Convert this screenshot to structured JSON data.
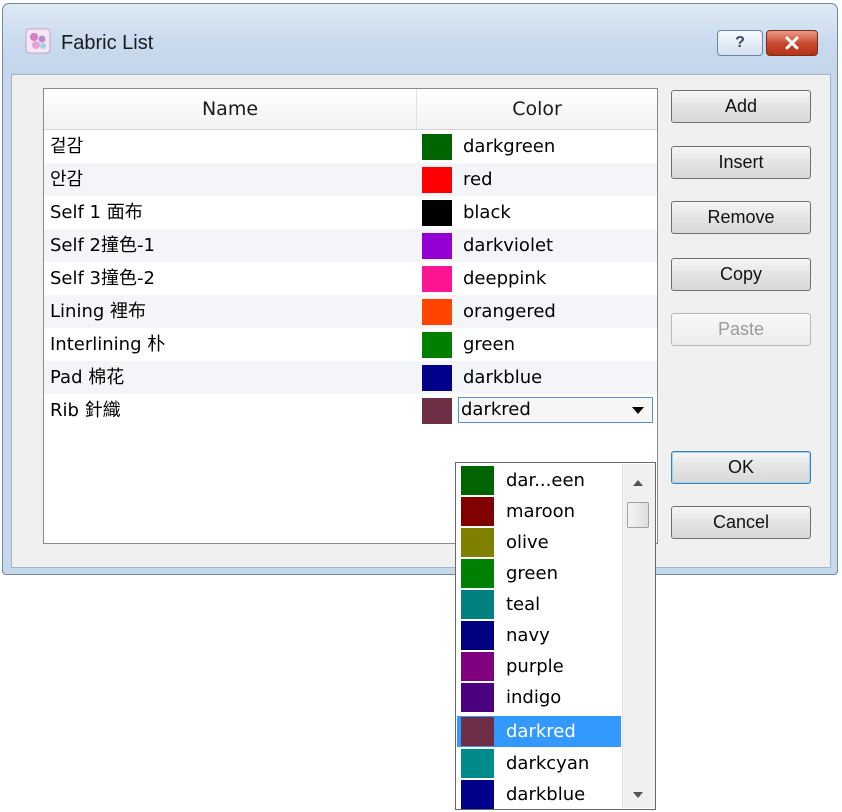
{
  "window": {
    "title": "Fabric List",
    "help_label": "?",
    "close_label": "✕"
  },
  "table": {
    "headers": {
      "name": "Name",
      "color": "Color"
    },
    "rows": [
      {
        "name": "겉감",
        "color_name": "darkgreen",
        "swatch": "#006400"
      },
      {
        "name": "안감",
        "color_name": "red",
        "swatch": "#ff0000"
      },
      {
        "name": "Self 1 面布",
        "color_name": "black",
        "swatch": "#000000"
      },
      {
        "name": "Self 2撞色-1",
        "color_name": "darkviolet",
        "swatch": "#9400d3"
      },
      {
        "name": "Self 3撞色-2",
        "color_name": "deeppink",
        "swatch": "#ff1493"
      },
      {
        "name": "Lining 裡布",
        "color_name": "orangered",
        "swatch": "#ff4500"
      },
      {
        "name": "Interlining 朴",
        "color_name": "green",
        "swatch": "#008000"
      },
      {
        "name": "Pad 棉花",
        "color_name": "darkblue",
        "swatch": "#00008b"
      },
      {
        "name": "Rib 針織",
        "color_name": "darkred",
        "swatch": "#6d2e46"
      }
    ]
  },
  "buttons": {
    "add": "Add",
    "insert": "Insert",
    "remove": "Remove",
    "copy": "Copy",
    "paste": "Paste",
    "ok": "OK",
    "cancel": "Cancel"
  },
  "dropdown": {
    "selected_value": "darkred",
    "items": [
      {
        "label": "dar...een",
        "swatch": "#006400"
      },
      {
        "label": "maroon",
        "swatch": "#800000"
      },
      {
        "label": "olive",
        "swatch": "#808000"
      },
      {
        "label": "green",
        "swatch": "#008000"
      },
      {
        "label": "teal",
        "swatch": "#008080"
      },
      {
        "label": "navy",
        "swatch": "#000080"
      },
      {
        "label": "purple",
        "swatch": "#800080"
      },
      {
        "label": "indigo",
        "swatch": "#4b0082"
      },
      {
        "label": "darkred",
        "swatch": "#6d2e46",
        "selected": true
      },
      {
        "label": "darkcyan",
        "swatch": "#008b8b"
      },
      {
        "label": "darkblue",
        "swatch": "#00008b"
      }
    ]
  }
}
